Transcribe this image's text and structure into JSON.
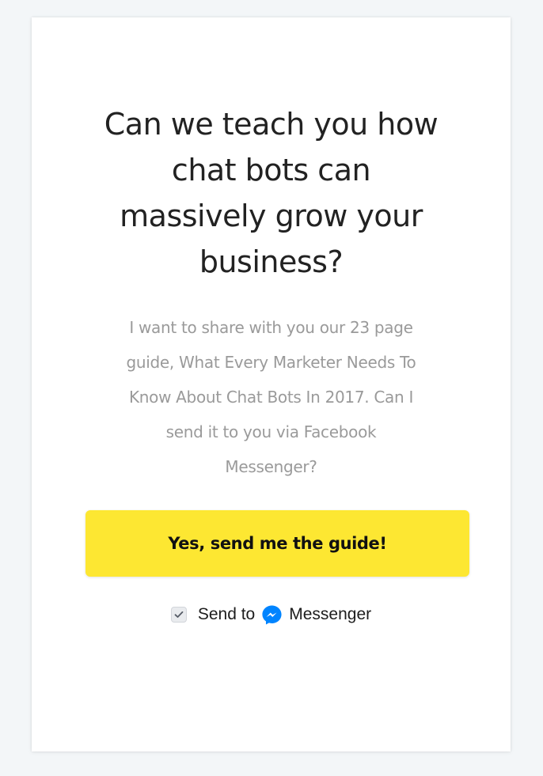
{
  "headline": {
    "lines": [
      "Can we teach you how",
      "chat bots can",
      "massively grow your",
      "business?"
    ]
  },
  "description": {
    "lines": [
      "I want to share with you our 23 page",
      "guide, What Every Marketer Needs To",
      "Know About Chat Bots In 2017. Can I",
      "send it to you via Facebook",
      "Messenger?"
    ]
  },
  "cta": {
    "label": "Yes, send me the guide!",
    "color": "#fde732"
  },
  "send_to": {
    "checked": true,
    "prefix": "Send to",
    "service": "Messenger",
    "icon": "messenger-icon",
    "icon_color": "#0084ff"
  }
}
